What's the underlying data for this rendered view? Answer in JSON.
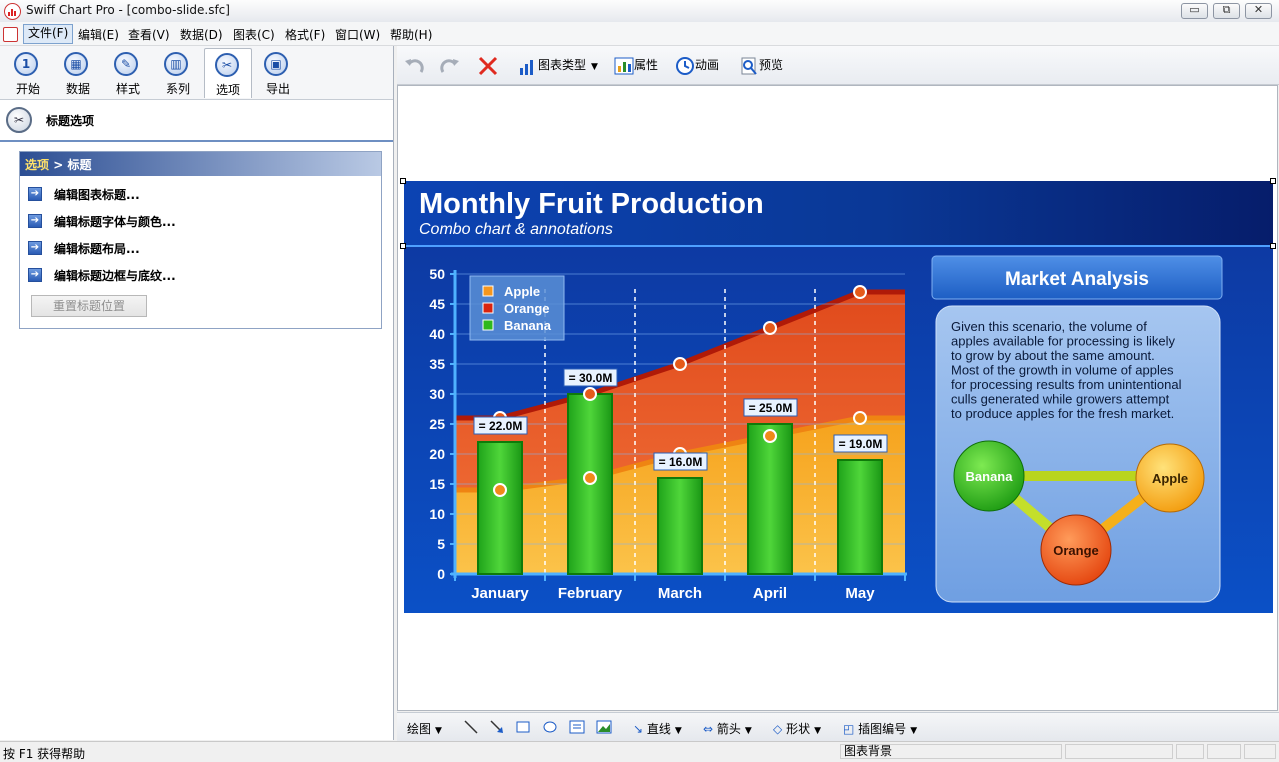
{
  "window": {
    "title": "Swiff Chart Pro - [combo-slide.sfc]",
    "min_glyph": "▭",
    "max_glyph": "⧉",
    "close_glyph": "✕"
  },
  "menu": [
    "文件(F)",
    "编辑(E)",
    "查看(V)",
    "数据(D)",
    "图表(C)",
    "格式(F)",
    "窗口(W)",
    "帮助(H)"
  ],
  "left_toolbar": [
    {
      "label": "开始",
      "icon": "start-icon",
      "glyph": "1"
    },
    {
      "label": "数据",
      "icon": "data-grid-icon",
      "glyph": "▦"
    },
    {
      "label": "样式",
      "icon": "style-brush-icon",
      "glyph": "✎"
    },
    {
      "label": "系列",
      "icon": "series-bars-icon",
      "glyph": "▥"
    },
    {
      "label": "选项",
      "icon": "options-tools-icon",
      "glyph": "✂"
    },
    {
      "label": "导出",
      "icon": "export-disk-icon",
      "glyph": "▣"
    }
  ],
  "section": {
    "title": "标题选项",
    "icon_glyph": "✂"
  },
  "options": {
    "crumb_root": "选项",
    "crumb_sep": " > ",
    "crumb_leaf": "标题",
    "links": [
      "编辑图表标题...",
      "编辑标题字体与颜色...",
      "编辑标题布局...",
      "编辑标题边框与底纹..."
    ],
    "reset": "重置标题位置"
  },
  "right_toolbar": {
    "chart_type": "图表类型",
    "properties": "属性",
    "animation": "动画",
    "preview": "预览"
  },
  "bottom_toolbar": {
    "draw": "绘图",
    "line": "直线",
    "arrow": "箭头",
    "shape": "形状",
    "insert_number": "插图编号"
  },
  "status": {
    "help": "按 F1 获得帮助",
    "context": "图表背景"
  },
  "slide": {
    "title": "Monthly Fruit Production",
    "subtitle": "Combo chart & annotations",
    "analysis_title": "Market Analysis",
    "analysis_text": [
      "Given this scenario, the volume of",
      "apples available for processing is likely",
      "to grow by about the same amount.",
      "Most of the growth in volume of apples",
      "for processing results from unintentional",
      "culls generated while growers attempt",
      "to produce apples for the fresh market."
    ],
    "nodes": [
      "Banana",
      "Apple",
      "Orange"
    ]
  },
  "colors": {
    "apple": "#f5961e",
    "orange": "#d8230f",
    "banana": "#2fb81c",
    "slide_bg": "#0d3ea8"
  },
  "chart_data": {
    "type": "bar",
    "categories": [
      "January",
      "February",
      "March",
      "April",
      "May"
    ],
    "series": [
      {
        "name": "Apple",
        "type": "area",
        "values": [
          14,
          16,
          20,
          23,
          26
        ]
      },
      {
        "name": "Orange",
        "type": "area",
        "values": [
          26,
          30,
          35,
          41,
          47
        ]
      },
      {
        "name": "Banana",
        "type": "bar",
        "values": [
          22,
          30,
          16,
          25,
          19
        ]
      }
    ],
    "data_labels": [
      "= 22.0M",
      "= 30.0M",
      "= 16.0M",
      "= 25.0M",
      "= 19.0M"
    ],
    "yticks": [
      "0",
      "5",
      "10",
      "15",
      "20",
      "25",
      "30",
      "35",
      "40",
      "45",
      "50"
    ],
    "ylim": [
      0,
      50
    ],
    "legend": "top-left",
    "grid": true
  }
}
